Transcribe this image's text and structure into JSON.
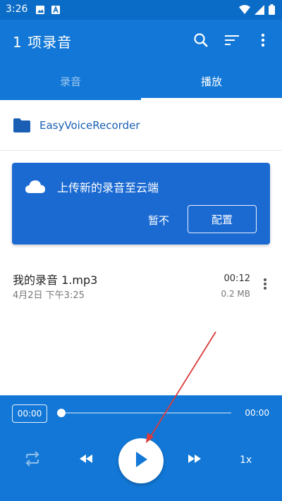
{
  "status_bar": {
    "time": "3:26"
  },
  "app_bar": {
    "title": "1 项录音"
  },
  "tabs": [
    {
      "label": "录音",
      "active": false
    },
    {
      "label": "播放",
      "active": true
    }
  ],
  "folder": {
    "name": "EasyVoiceRecorder"
  },
  "upload_card": {
    "message": "上传新的录音至云端",
    "later_label": "暂不",
    "config_label": "配置"
  },
  "recordings": [
    {
      "name": "我的录音 1.mp3",
      "date": "4月2日 下午3:25",
      "duration": "00:12",
      "size": "0.2 MB"
    }
  ],
  "player": {
    "current_time": "00:00",
    "total_time": "00:00",
    "speed": "1x",
    "progress": 0
  },
  "colors": {
    "primary": "#1277d6",
    "status_bar": "#0a6cc6",
    "card": "#1a6ad2",
    "folder_text": "#1a5fb4",
    "annotation": "#d93b3b"
  }
}
